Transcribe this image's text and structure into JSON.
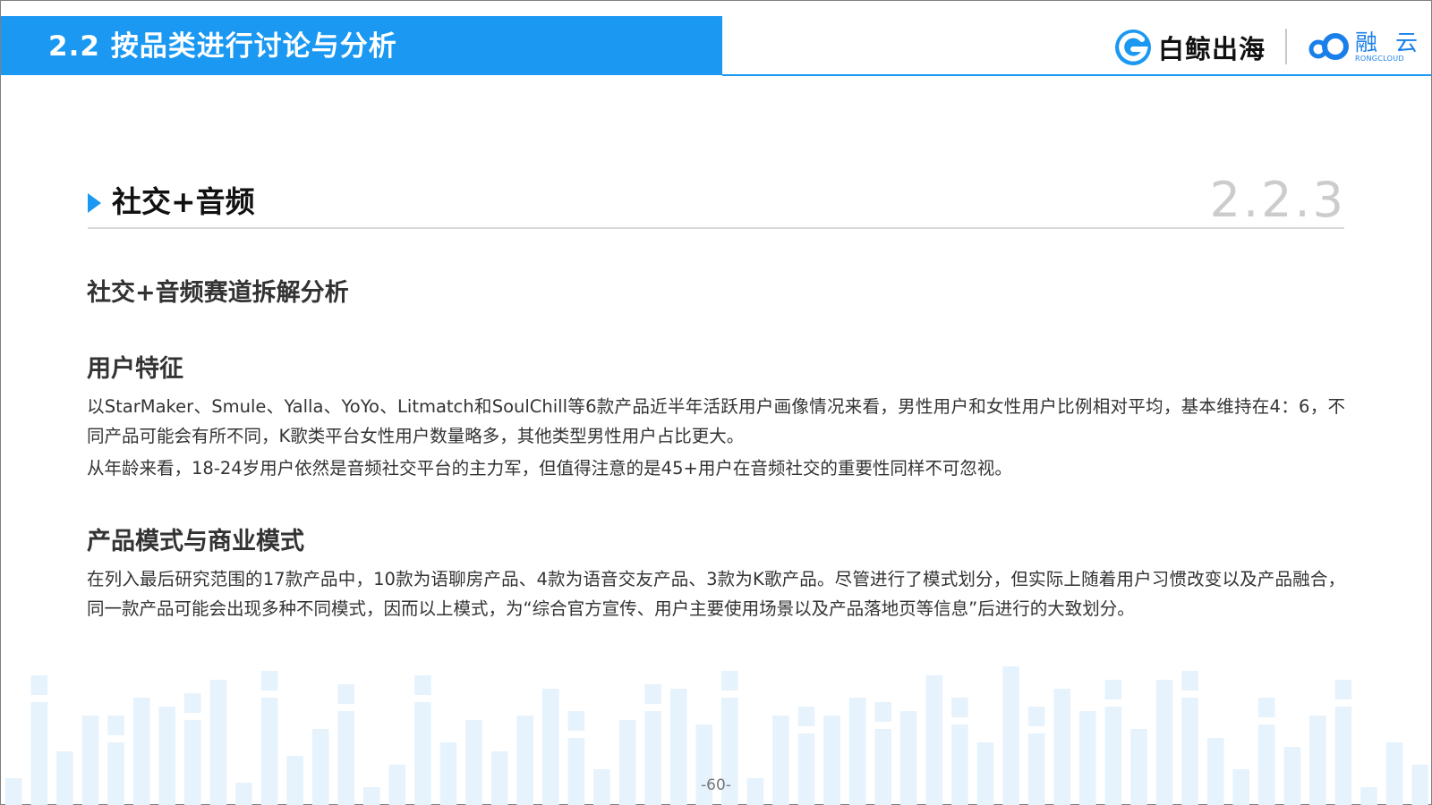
{
  "header": {
    "title": "2.2 按品类进行讨论与分析",
    "brand_left": "白鲸出海",
    "brand_right": "融 云",
    "brand_right_sub": "RONGCLOUD",
    "accent_color": "#1a98f2"
  },
  "section": {
    "title": "社交+音频",
    "number": "2.2.3"
  },
  "content": {
    "subtitle": "社交+音频赛道拆解分析",
    "user_heading": "用户特征",
    "user_para_1": "以StarMaker、Smule、Yalla、YoYo、Litmatch和SoulChill等6款产品近半年活跃用户画像情况来看，男性用户和女性用户比例相对平均，基本维持在4：6，不同产品可能会有所不同，K歌类平台女性用户数量略多，其他类型男性用户占比更大。",
    "user_para_2": "从年龄来看，18-24岁用户依然是音频社交平台的主力军，但值得注意的是45+用户在音频社交的重要性同样不可忽视。",
    "model_heading": "产品模式与商业模式",
    "model_para": "在列入最后研究范围的17款产品中，10款为语聊房产品、4款为语音交友产品、3款为K歌产品。尽管进行了模式划分，但实际上随着用户习惯改变以及产品融合，同一款产品可能会出现多种不同模式，因而以上模式，为“综合官方宣传、用户主要使用场景以及产品落地页等信息”后进行的大致划分。"
  },
  "footer": {
    "page_number": "-60-"
  },
  "icons": {
    "brand_left_logo": "g-swirl-logo-icon",
    "brand_right_logo": "cloud-loop-logo-icon",
    "section_marker": "triangle-right-icon"
  }
}
